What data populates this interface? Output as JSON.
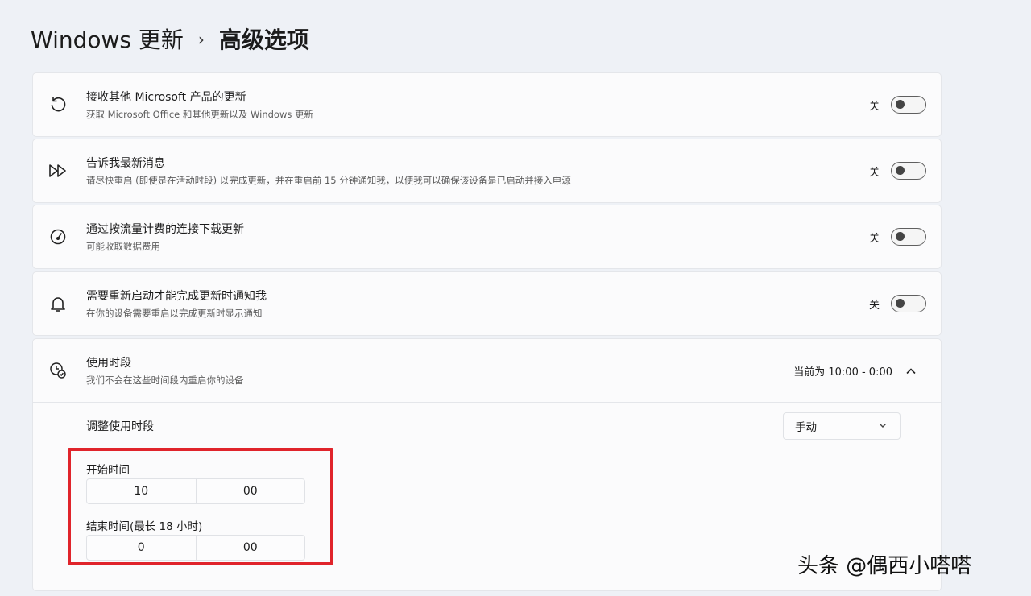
{
  "breadcrumb": {
    "parent": "Windows 更新",
    "separator": "›",
    "current": "高级选项"
  },
  "settings": [
    {
      "icon": "refresh-icon",
      "title": "接收其他 Microsoft 产品的更新",
      "subtitle": "获取 Microsoft Office 和其他更新以及 Windows 更新",
      "state": "关",
      "on": false
    },
    {
      "icon": "fast-forward-icon",
      "title": "告诉我最新消息",
      "subtitle": "请尽快重启 (即使是在活动时段) 以完成更新，并在重启前 15 分钟通知我，以便我可以确保该设备是已启动并接入电源",
      "state": "关",
      "on": false
    },
    {
      "icon": "speedometer-icon",
      "title": "通过按流量计费的连接下载更新",
      "subtitle": "可能收取数据费用",
      "state": "关",
      "on": false
    },
    {
      "icon": "bell-icon",
      "title": "需要重新启动才能完成更新时通知我",
      "subtitle": "在你的设备需要重启以完成更新时显示通知",
      "state": "关",
      "on": false
    }
  ],
  "active_hours": {
    "icon": "active-hours-icon",
    "title": "使用时段",
    "subtitle": "我们不会在这些时间段内重启你的设备",
    "current": "当前为 10:00 - 0:00",
    "adjust_label": "调整使用时段",
    "mode_value": "手动",
    "start_label": "开始时间",
    "start_hour": "10",
    "start_minute": "00",
    "end_label": "结束时间(最长 18 小时)",
    "end_hour": "0",
    "end_minute": "00"
  },
  "watermark": "头条 @偶西小嗒嗒",
  "colors": {
    "highlight": "#e0242b",
    "background": "#eef1f6",
    "card": "#fbfbfc"
  }
}
